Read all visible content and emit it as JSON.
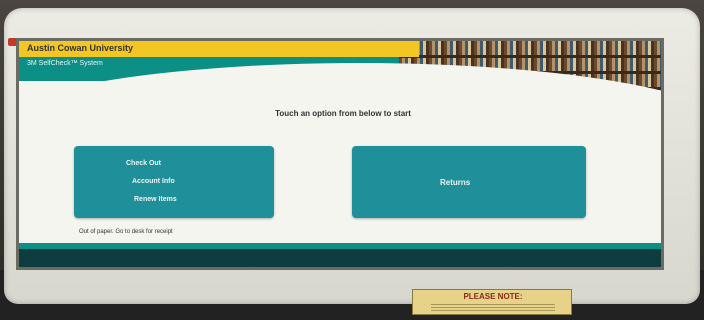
{
  "kiosk": {
    "university_name": "Austin Cowan University",
    "system_name": "3M SelfCheck™ System",
    "prompt": "Touch an option from below to start",
    "left_button": {
      "items": [
        "Check Out",
        "Account Info",
        "Renew Items"
      ]
    },
    "right_button": {
      "label": "Returns"
    },
    "status_message": "Out of paper. Go to desk for receipt"
  },
  "notice": {
    "title": "PLEASE NOTE:"
  },
  "colors": {
    "teal": "#0c8f85",
    "button": "#1f8f9a",
    "yellow": "#f2c724"
  }
}
